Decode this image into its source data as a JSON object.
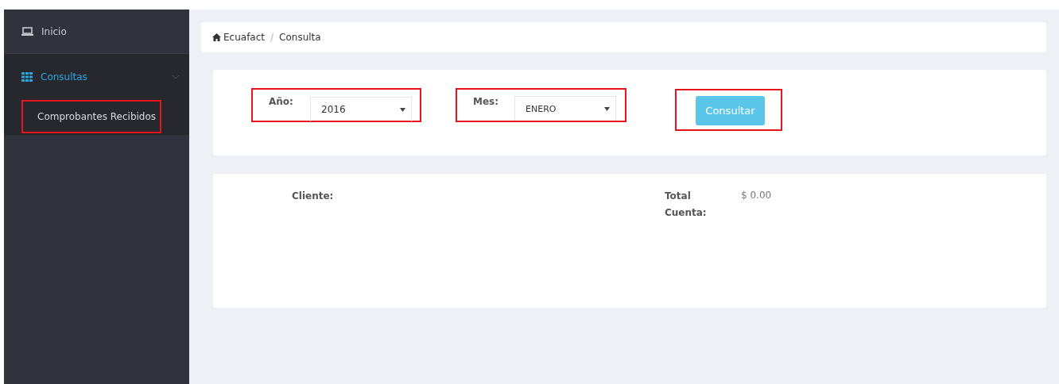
{
  "sidebar": {
    "items": [
      {
        "label": "Inicio",
        "kind": "laptop",
        "selected": false
      },
      {
        "label": "Consultas",
        "kind": "grid",
        "selected": true,
        "expanded": true,
        "children": [
          {
            "label": "Comprobantes Recibidos",
            "highlighted": true
          }
        ]
      }
    ]
  },
  "breadcrumb": {
    "separator": "/",
    "items": [
      {
        "label": "Ecuafact",
        "kind": "home"
      },
      {
        "label": "Consulta",
        "kind": "page"
      }
    ]
  },
  "filters": [
    {
      "label": "Año:",
      "value": "2016",
      "highlighted": true
    },
    {
      "label": "Mes:",
      "value": "ENERO",
      "highlighted": true
    }
  ],
  "query_button": {
    "label": "Consultar",
    "highlighted": true
  },
  "summary": {
    "client_label": "Cliente:",
    "total_label": "Total Cuenta:",
    "total_value": "$ 0.00"
  }
}
